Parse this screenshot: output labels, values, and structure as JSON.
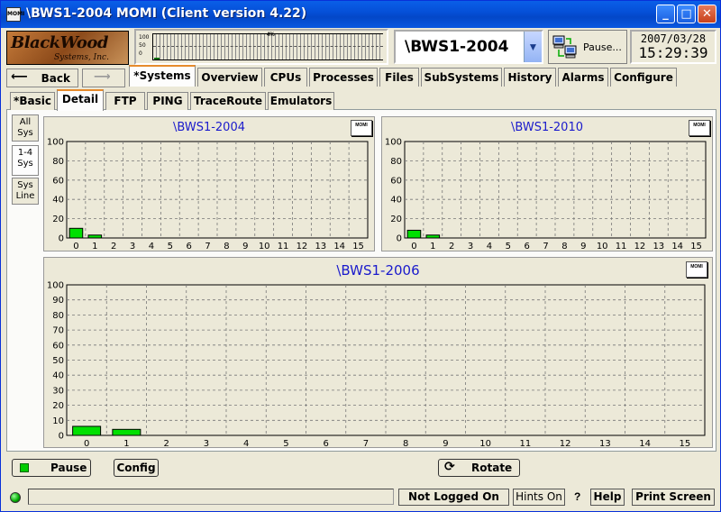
{
  "window": {
    "icon_label": "MOMI",
    "title": "\\BWS1-2004 MOMI (Client version 4.22)",
    "min_label": "_",
    "max_label": "□",
    "close_label": "✕"
  },
  "header": {
    "logo_text_top": "BlackWood",
    "logo_text_sub": "Systems, Inc.",
    "sparkline": {
      "tick_labels": [
        "100",
        "50",
        "0"
      ],
      "percent_label": "4%",
      "current_value": 4
    },
    "system_selector": {
      "value": "\\BWS1-2004",
      "dropdown_icon": "chevron-down-icon"
    },
    "pause_label": "Pause...",
    "date": "2007/03/28",
    "time": "15:29:39"
  },
  "nav": {
    "back_label": "Back",
    "forward_label": ""
  },
  "main_tabs": [
    {
      "label": "*Systems",
      "active": true
    },
    {
      "label": "Overview"
    },
    {
      "label": "CPUs"
    },
    {
      "label": "Processes"
    },
    {
      "label": "Files"
    },
    {
      "label": "SubSystems"
    },
    {
      "label": "History"
    },
    {
      "label": "Alarms"
    },
    {
      "label": "Configure"
    }
  ],
  "sub_tabs": [
    {
      "label": "*Basic"
    },
    {
      "label": "Detail",
      "active": true
    },
    {
      "label": "FTP"
    },
    {
      "label": "PING"
    },
    {
      "label": "TraceRoute"
    },
    {
      "label": "Emulators"
    }
  ],
  "side_buttons": [
    {
      "line1": "All",
      "line2": "Sys"
    },
    {
      "line1": "1-4",
      "line2": "Sys",
      "active": true
    },
    {
      "line1": "Sys",
      "line2": "Line"
    }
  ],
  "momi_label": "MOMI",
  "chart_data": [
    {
      "type": "bar",
      "title": "\\BWS1-2004",
      "categories": [
        "0",
        "1",
        "2",
        "3",
        "4",
        "5",
        "6",
        "7",
        "8",
        "9",
        "10",
        "11",
        "12",
        "13",
        "14",
        "15"
      ],
      "values": [
        10,
        3,
        0,
        0,
        0,
        0,
        0,
        0,
        0,
        0,
        0,
        0,
        0,
        0,
        0,
        0
      ],
      "ylim": [
        0,
        100
      ],
      "yticks": [
        0,
        20,
        40,
        60,
        80,
        100
      ],
      "grid": true,
      "bar_color": "#00e000"
    },
    {
      "type": "bar",
      "title": "\\BWS1-2010",
      "categories": [
        "0",
        "1",
        "2",
        "3",
        "4",
        "5",
        "6",
        "7",
        "8",
        "9",
        "10",
        "11",
        "12",
        "13",
        "14",
        "15"
      ],
      "values": [
        8,
        3,
        0,
        0,
        0,
        0,
        0,
        0,
        0,
        0,
        0,
        0,
        0,
        0,
        0,
        0
      ],
      "ylim": [
        0,
        100
      ],
      "yticks": [
        0,
        20,
        40,
        60,
        80,
        100
      ],
      "grid": true,
      "bar_color": "#00e000"
    },
    {
      "type": "bar",
      "title": "\\BWS1-2006",
      "categories": [
        "0",
        "1",
        "2",
        "3",
        "4",
        "5",
        "6",
        "7",
        "8",
        "9",
        "10",
        "11",
        "12",
        "13",
        "14",
        "15"
      ],
      "values": [
        6,
        4,
        0,
        0,
        0,
        0,
        0,
        0,
        0,
        0,
        0,
        0,
        0,
        0,
        0,
        0
      ],
      "ylim": [
        0,
        100
      ],
      "yticks": [
        0,
        10,
        20,
        30,
        40,
        50,
        60,
        70,
        80,
        90,
        100
      ],
      "grid": true,
      "bar_color": "#00e000"
    }
  ],
  "bottom": {
    "pause_label": "Pause",
    "config_label": "Config",
    "rotate_label": "Rotate"
  },
  "status": {
    "message": "",
    "logged_label": "Not Logged On",
    "hints_label": "Hints On",
    "question_label": "?",
    "help_label": "Help",
    "print_label": "Print Screen"
  }
}
